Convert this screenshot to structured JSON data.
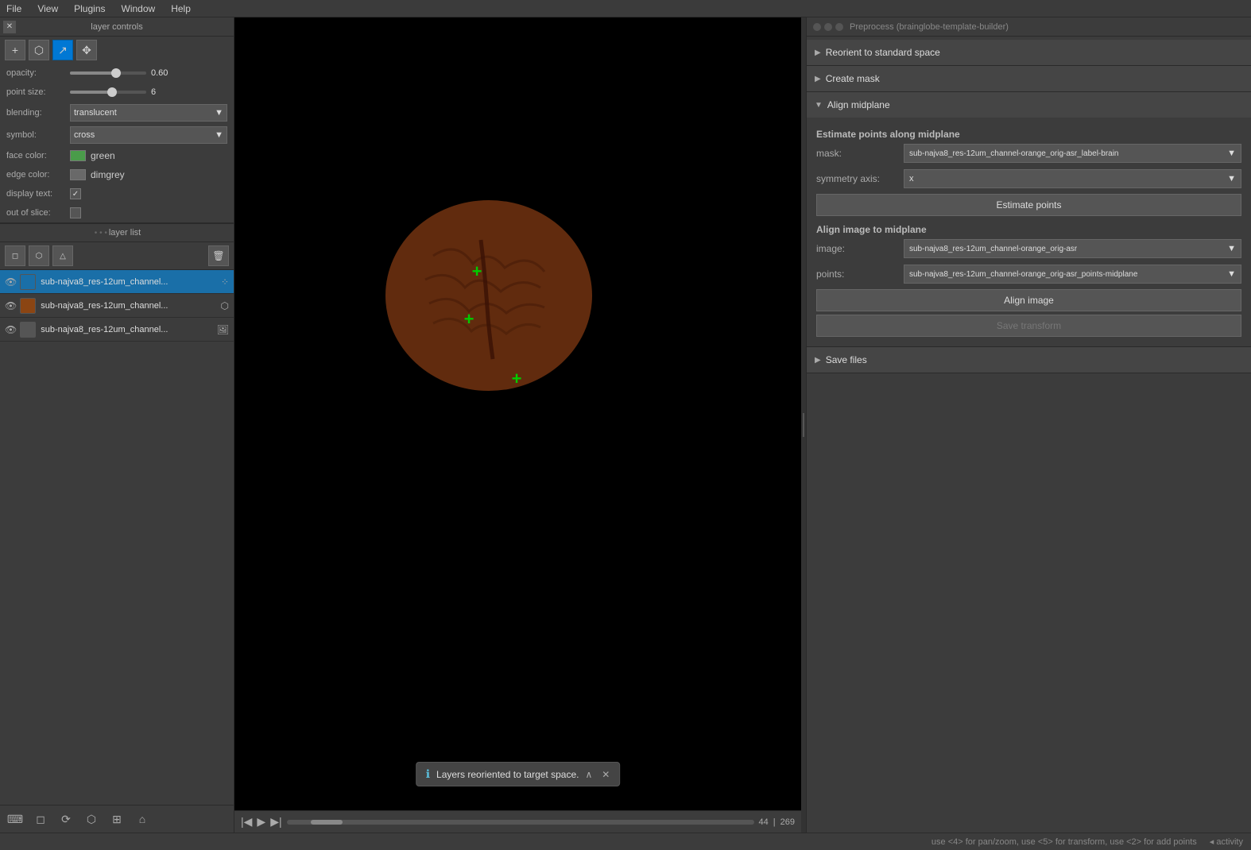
{
  "menubar": {
    "items": [
      "File",
      "View",
      "Plugins",
      "Window",
      "Help"
    ]
  },
  "left_panel": {
    "layer_controls_title": "layer controls",
    "toolbar": {
      "add_btn": "+",
      "select_btn": "⬡",
      "transform_btn": "↗",
      "move_btn": "✥"
    },
    "properties": {
      "opacity_label": "opacity:",
      "opacity_value": "0.60",
      "opacity_percent": 60,
      "point_size_label": "point size:",
      "point_size_value": "6",
      "blending_label": "blending:",
      "blending_value": "translucent",
      "symbol_label": "symbol:",
      "symbol_value": "cross",
      "face_color_label": "face color:",
      "face_color_value": "green",
      "face_color_hex": "#4a9c4a",
      "edge_color_label": "edge color:",
      "edge_color_value": "dimgrey",
      "edge_color_hex": "#696969",
      "display_text_label": "display text:",
      "out_of_slice_label": "out of slice:"
    },
    "layer_list_title": "layer list",
    "layer_toolbar": {
      "select_btn": "◻",
      "label_btn": "⬡",
      "delete_btn": "🗑"
    },
    "layers": [
      {
        "name": "sub-najva8_res-12um_channel...",
        "full_name": "sub-najva8_res-12um_channel-orange_orig-asr_points-midplane",
        "type": "points",
        "color": "#1a6fa8",
        "active": true,
        "thumb_color": "#1a6fa8"
      },
      {
        "name": "sub-najva8_res-12um_channel...",
        "full_name": "sub-najva8_res-12um_channel-orange_orig-asr_label-brain",
        "type": "labels",
        "color": "#8b4513",
        "active": false,
        "thumb_color": "#8b4513"
      },
      {
        "name": "sub-najva8_res-12um_channel...",
        "full_name": "sub-najva8_res-12um_channel-orange_orig-asr",
        "type": "image",
        "color": "#555",
        "active": false,
        "thumb_color": "#555"
      }
    ],
    "bottom_tools": [
      "⌨",
      "◻",
      "⟳",
      "⬡",
      "⊞",
      "⌂"
    ]
  },
  "canvas": {
    "notification": "Layers reoriented to target space.",
    "frame_current": "44",
    "frame_total": "269"
  },
  "right_panel": {
    "title": "Preprocess (brainglobe-template-builder)",
    "sections": [
      {
        "id": "reorient",
        "label": "Reorient to standard space",
        "collapsed": true,
        "arrow": "▶"
      },
      {
        "id": "create_mask",
        "label": "Create mask",
        "collapsed": true,
        "arrow": "▶"
      },
      {
        "id": "align_midplane",
        "label": "Align midplane",
        "collapsed": false,
        "arrow": "▼",
        "subsections": [
          {
            "title": "Estimate points along midplane",
            "fields": [
              {
                "label": "mask:",
                "value": "sub-najva8_res-12um_channel-orange_orig-asr_label-brain",
                "id": "mask_select"
              },
              {
                "label": "symmetry axis:",
                "value": "x",
                "id": "symmetry_axis_select"
              }
            ],
            "action": {
              "label": "Estimate points",
              "id": "estimate_points_btn",
              "disabled": false
            }
          },
          {
            "title": "Align image to midplane",
            "fields": [
              {
                "label": "image:",
                "value": "sub-najva8_res-12um_channel-orange_orig-asr",
                "id": "image_select"
              },
              {
                "label": "points:",
                "value": "sub-najva8_res-12um_channel-orange_orig-asr_points-midplane",
                "id": "points_select"
              }
            ],
            "actions": [
              {
                "label": "Align image",
                "id": "align_image_btn",
                "disabled": false
              },
              {
                "label": "Save transform",
                "id": "save_transform_btn",
                "disabled": true
              }
            ]
          }
        ]
      },
      {
        "id": "save_files",
        "label": "Save files",
        "collapsed": true,
        "arrow": "▶"
      }
    ]
  },
  "status_bar": {
    "hint": "use <4> for pan/zoom, use <5> for transform, use <2> for add points",
    "suffix": "◂ activity"
  }
}
